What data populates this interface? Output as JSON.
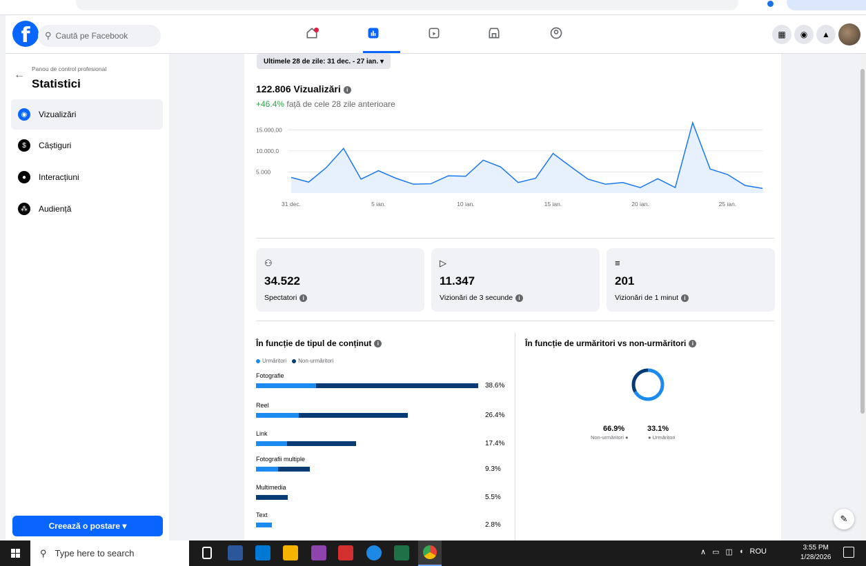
{
  "facebook": {
    "search_placeholder": "Caută pe Facebook"
  },
  "sidebar": {
    "panel_label": "Panou de control profesional",
    "title": "Statistici",
    "items": [
      {
        "label": "Vizualizări",
        "icon": "eye-icon",
        "active": true
      },
      {
        "label": "Câștiguri",
        "icon": "dollar-icon",
        "active": false
      },
      {
        "label": "Interacțiuni",
        "icon": "chat-icon",
        "active": false
      },
      {
        "label": "Audiență",
        "icon": "people-icon",
        "active": false
      }
    ],
    "create_button": "Creează o postare ▾"
  },
  "main": {
    "date_range": "Ultimele 28 de zile: 31 dec. - 27 ian. ▾",
    "views_title": "122.806 Vizualizări",
    "views_delta": "+46.4%",
    "views_delta_rest": " față de cele 28 zile anterioare",
    "stats": [
      {
        "value": "34.522",
        "label": "Spectatori",
        "icon": "person-icon"
      },
      {
        "value": "11.347",
        "label": "Vizionări de 3 secunde",
        "icon": "play-icon"
      },
      {
        "value": "201",
        "label": "Vizionări de 1 minut",
        "icon": "playlist-icon"
      }
    ],
    "content_type_title": "În funcție de tipul de conținut",
    "legend_followers": "Urmăritori",
    "legend_nonfollowers": "Non-urmăritori",
    "followers_title": "În funcție de urmăritori vs non-urmăritori",
    "donut": {
      "nonfollowers_pct": "66.9%",
      "nonfollowers_label": "Non-urmăritori ●",
      "followers_pct": "33.1%",
      "followers_label": "● Urmăritori",
      "nonfollowers_value": 66.9,
      "followers_value": 33.1
    }
  },
  "chart_data": [
    {
      "type": "area",
      "x": [
        "31 dec.",
        "1 ian.",
        "2 ian.",
        "3 ian.",
        "4 ian.",
        "5 ian.",
        "6 ian.",
        "7 ian.",
        "8 ian.",
        "9 ian.",
        "10 ian.",
        "11 ian.",
        "12 ian.",
        "13 ian.",
        "14 ian.",
        "15 ian.",
        "16 ian.",
        "17 ian.",
        "18 ian.",
        "19 ian.",
        "20 ian.",
        "21 ian.",
        "22 ian.",
        "23 ian.",
        "24 ian.",
        "25 ian.",
        "26 ian.",
        "27 ian."
      ],
      "x_ticks": [
        "31 dec.",
        "5 ian.",
        "10 ian.",
        "15 ian.",
        "20 ian.",
        "25 ian."
      ],
      "y_ticks": [
        "15.000,00",
        "10.000,0",
        "5.000"
      ],
      "y_tick_values": [
        15000,
        10000,
        5000
      ],
      "values": [
        3700,
        2600,
        6000,
        10600,
        3300,
        5300,
        3500,
        2100,
        2200,
        4100,
        4000,
        7800,
        6200,
        2500,
        3500,
        9400,
        6300,
        3300,
        2100,
        2500,
        1300,
        3400,
        1300,
        16700,
        5700,
        4400,
        1800,
        1100
      ],
      "ylim": [
        0,
        16700
      ],
      "color": "#1877f2",
      "fill": "#e7f0fd",
      "grid": true
    },
    {
      "type": "bar",
      "categories": [
        "Fotografie",
        "Reel",
        "Link",
        "Fotografii multiple",
        "Multimedia",
        "Text"
      ],
      "totals": [
        38.6,
        26.4,
        17.4,
        9.3,
        5.5,
        2.8
      ],
      "labels": [
        "38.6%",
        "26.4%",
        "17.4%",
        "9.3%",
        "5.5%",
        "2.8%"
      ],
      "series": [
        {
          "name": "Urmăritori",
          "color": "#1b8bf0",
          "share": [
            0.27,
            0.28,
            0.31,
            0.41,
            0.0,
            1.0
          ]
        },
        {
          "name": "Non-urmăritori",
          "color": "#073b73"
        }
      ]
    }
  ],
  "taskbar": {
    "search_placeholder": "Type here to search",
    "tray_lang": "ROU",
    "time": "3:55 PM",
    "date": "1/28/2026"
  }
}
